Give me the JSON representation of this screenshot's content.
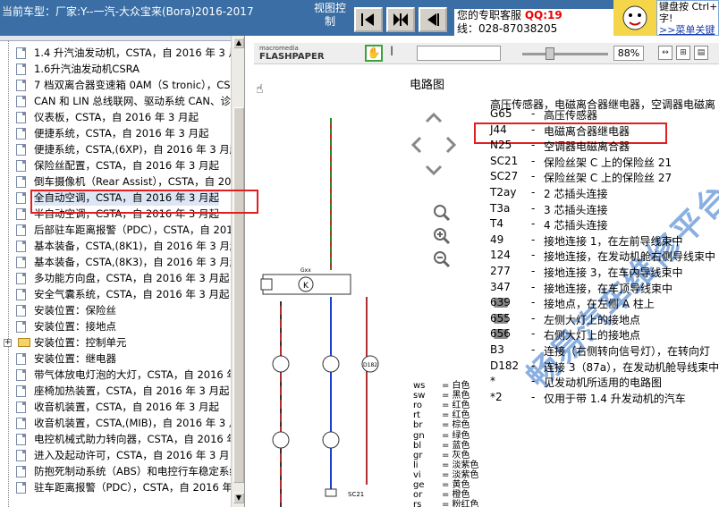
{
  "topbar": {
    "car_label": "当前车型：厂家:Y--一汽-大众宝来(Bora)2016-2017",
    "view_ctrl": "视图控制",
    "service_line1_prefix": "您的专职客服",
    "service_qq": "QQ:19",
    "service_line2": "线：028-87038205",
    "ad_line1": "键盘按 Ctrl+",
    "ad_line2": "字!",
    "ad_link": ">>菜单关键"
  },
  "tree": {
    "items": [
      {
        "label": "1.4 升汽油发动机，CSTA，自 2016 年 3 月",
        "type": "doc"
      },
      {
        "label": "1.6升汽油发动机CSRA",
        "type": "doc"
      },
      {
        "label": "7 档双离合器变速箱 0AM（S tronic），CS",
        "type": "doc"
      },
      {
        "label": "CAN 和 LIN 总线联网、驱动系统 CAN、诊",
        "type": "doc"
      },
      {
        "label": "仪表板，CSTA，自 2016 年 3 月起",
        "type": "doc"
      },
      {
        "label": "便捷系统，CSTA，自 2016 年 3 月起",
        "type": "doc"
      },
      {
        "label": "便捷系统，CSTA,(6XP)，自 2016 年 3 月起",
        "type": "doc"
      },
      {
        "label": "保险丝配置，CSTA，自 2016 年 3 月起",
        "type": "doc"
      },
      {
        "label": "倒车摄像机（Rear Assist），CSTA，自 20",
        "type": "doc"
      },
      {
        "label": "全自动空调，CSTA，自 2016 年 3 月起",
        "type": "doc",
        "selected": true
      },
      {
        "label": "半自动空调，CSTA，自 2016 年 3 月起",
        "type": "doc"
      },
      {
        "label": "后部驻车距离报警（PDC），CSTA，自 201",
        "type": "doc"
      },
      {
        "label": "基本装备，CSTA,(8K1)，自 2016 年 3 月起",
        "type": "doc"
      },
      {
        "label": "基本装备，CSTA,(8K3)，自 2016 年 3 月起",
        "type": "doc"
      },
      {
        "label": "多功能方向盘，CSTA，自 2016 年 3 月起",
        "type": "doc"
      },
      {
        "label": "安全气囊系统，CSTA，自 2016 年 3 月起",
        "type": "doc"
      },
      {
        "label": "安装位置：保险丝",
        "type": "doc"
      },
      {
        "label": "安装位置：接地点",
        "type": "doc"
      },
      {
        "label": "安装位置：控制单元",
        "type": "folder"
      },
      {
        "label": "安装位置：继电器",
        "type": "doc"
      },
      {
        "label": "带气体放电灯泡的大灯，CSTA，自 2016 年",
        "type": "doc"
      },
      {
        "label": "座椅加热装置，CSTA，自 2016 年 3 月起",
        "type": "doc"
      },
      {
        "label": "收音机装置，CSTA，自 2016 年 3 月起",
        "type": "doc"
      },
      {
        "label": "收音机装置，CSTA,(MIB)，自 2016 年 3 月",
        "type": "doc"
      },
      {
        "label": "电控机械式助力转向器，CSTA，自 2016 年",
        "type": "doc"
      },
      {
        "label": "进入及起动许可，CSTA，自 2016 年 3 月",
        "type": "doc"
      },
      {
        "label": "防抱死制动系统（ABS）和电控行车稳定系统",
        "type": "doc"
      },
      {
        "label": "驻车距离报警（PDC），CSTA，自 2016 年",
        "type": "doc"
      }
    ]
  },
  "fp_toolbar": {
    "logo_top": "macromedia",
    "logo_main": "FLASHPAPER",
    "zoom": "88%"
  },
  "doc": {
    "title": "电路图",
    "header": "高压传感器，电磁离合器继电器，空调器电磁离",
    "legend": [
      {
        "code": "G65",
        "desc": "高压传感器"
      },
      {
        "code": "J44",
        "desc": "电磁离合器继电器"
      },
      {
        "code": "N25",
        "desc": "空调器电磁离合器"
      },
      {
        "code": "SC21",
        "desc": "保险丝架 C 上的保险丝 21"
      },
      {
        "code": "SC27",
        "desc": "保险丝架 C 上的保险丝 27"
      },
      {
        "code": "T2ay",
        "desc": "2 芯插头连接"
      },
      {
        "code": "T3a",
        "desc": "3 芯插头连接"
      },
      {
        "code": "T4",
        "desc": "4 芯插头连接"
      },
      {
        "code": "49",
        "desc": "接地连接 1，在左前导线束中"
      },
      {
        "code": "124",
        "desc": "接地连接，在发动机舱右侧导线束中"
      },
      {
        "code": "277",
        "desc": "接地连接 3，在车内导线束中"
      },
      {
        "code": "347",
        "desc": "接地连接，在车顶导线束中"
      },
      {
        "code": "639",
        "desc": "接地点，在左侧 A 柱上",
        "camera": true
      },
      {
        "code": "655",
        "desc": "左侧大灯上的接地点",
        "camera": true
      },
      {
        "code": "656",
        "desc": "右侧大灯上的接地点",
        "camera": true
      },
      {
        "code": "B3",
        "desc": "连接（右侧转向信号灯），在转向灯"
      },
      {
        "code": "D182",
        "desc": "连接 3（87a），在发动机舱导线束中"
      },
      {
        "code": "*",
        "desc": "见发动机所适用的电路图"
      },
      {
        "code": "*2",
        "desc": "仅用于带 1.4 升发动机的汽车"
      }
    ],
    "colors": [
      {
        "code": "ws",
        "name": "= 白色"
      },
      {
        "code": "sw",
        "name": "= 黑色"
      },
      {
        "code": "ro",
        "name": "= 红色"
      },
      {
        "code": "rt",
        "name": "= 红色"
      },
      {
        "code": "br",
        "name": "= 棕色"
      },
      {
        "code": "gn",
        "name": "= 绿色"
      },
      {
        "code": "bl",
        "name": "= 蓝色"
      },
      {
        "code": "gr",
        "name": "= 灰色"
      },
      {
        "code": "li",
        "name": "= 淡紫色"
      },
      {
        "code": "vi",
        "name": "= 淡紫色"
      },
      {
        "code": "ge",
        "name": "= 黄色"
      },
      {
        "code": "or",
        "name": "= 橙色"
      },
      {
        "code": "rs",
        "name": "= 粉红色"
      }
    ],
    "watermark": "畅易汽车维修平台",
    "diagram": {
      "relay_label": "Gxx",
      "fuse_label": "SC21",
      "node_labels": [
        "D182"
      ]
    }
  },
  "colors": {
    "topbar": "#3a6ea5",
    "highlight": "#e02020",
    "watermark": "#2b6fc9"
  }
}
